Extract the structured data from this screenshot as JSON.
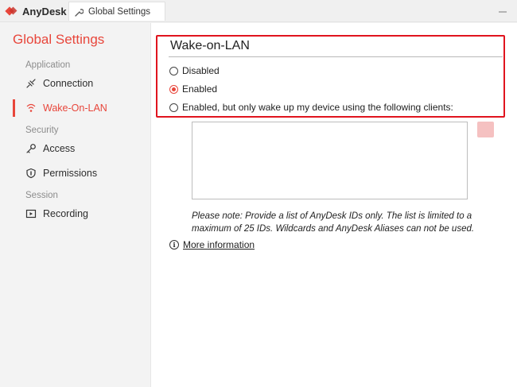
{
  "app": {
    "name": "AnyDesk",
    "brand_color": "#e8463b"
  },
  "tab": {
    "label": "Global Settings",
    "icon": "wrench-icon"
  },
  "sidebar": {
    "title": "Global Settings",
    "sections": [
      {
        "label": "Application"
      },
      {
        "label": "Security"
      },
      {
        "label": "Session"
      }
    ],
    "items": [
      {
        "label": "Connection",
        "icon": "connection-icon"
      },
      {
        "label": "Wake-On-LAN",
        "icon": "wifi-icon",
        "active": true
      },
      {
        "label": "Access",
        "icon": "key-icon"
      },
      {
        "label": "Permissions",
        "icon": "shield-icon"
      },
      {
        "label": "Recording",
        "icon": "play-icon"
      }
    ]
  },
  "main": {
    "title": "Wake-on-LAN",
    "options": [
      {
        "label": "Disabled",
        "selected": false
      },
      {
        "label": "Enabled",
        "selected": true
      },
      {
        "label": "Enabled, but only wake up my device using the following clients:",
        "selected": false
      }
    ],
    "note": "Please note: Provide a list of AnyDesk IDs only. The list is limited to a maximum of 25 IDs. Wildcards and AnyDesk Aliases can not be used.",
    "more_info": "More information",
    "highlight_color": "#e0141e"
  }
}
